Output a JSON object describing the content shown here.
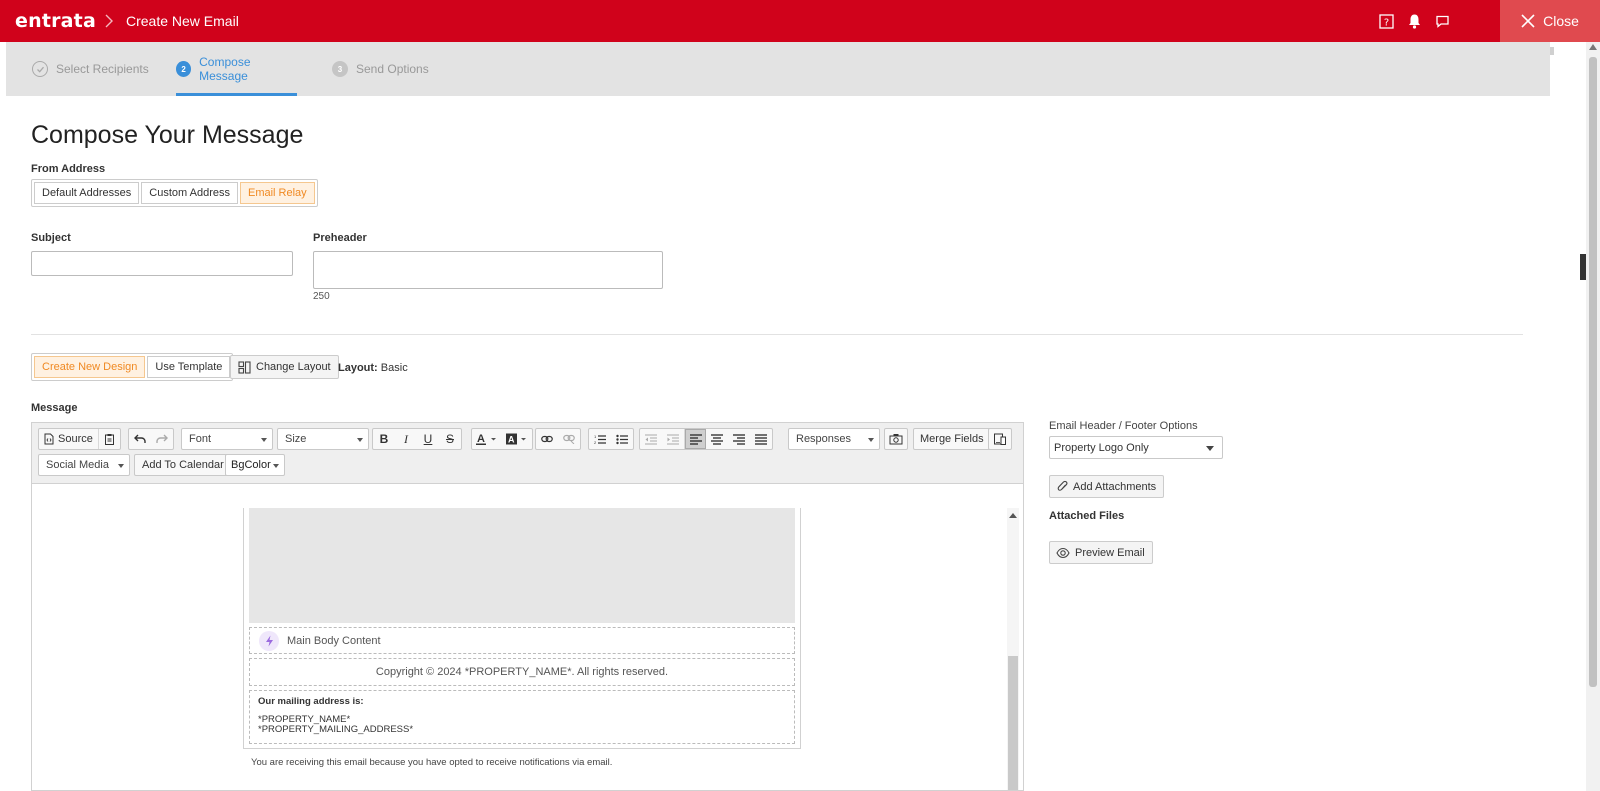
{
  "header": {
    "brand": "entrata",
    "page_name": "Create New Email",
    "close_label": "Close",
    "icons": [
      "help-icon",
      "bell-icon",
      "chat-icon"
    ]
  },
  "steps": [
    {
      "label": "Select Recipients",
      "state": "done"
    },
    {
      "number": "2",
      "label": "Compose Message",
      "state": "active"
    },
    {
      "number": "3",
      "label": "Send Options",
      "state": "pending"
    }
  ],
  "main": {
    "title": "Compose Your Message",
    "from_address": {
      "label": "From Address",
      "options": [
        "Default Addresses",
        "Custom Address",
        "Email Relay"
      ],
      "selected": "Email Relay"
    },
    "subject": {
      "label": "Subject",
      "value": ""
    },
    "preheader": {
      "label": "Preheader",
      "value": "",
      "char_count": "250"
    },
    "design": {
      "options": [
        "Create New Design",
        "Use Template"
      ],
      "selected": "Create New Design",
      "change_layout_label": "Change Layout",
      "layout_label": "Layout:",
      "layout_value": "Basic"
    },
    "message_label": "Message"
  },
  "toolbar": {
    "source_label": "Source",
    "font_label": "Font",
    "size_label": "Size",
    "responses_label": "Responses",
    "merge_fields_label": "Merge Fields",
    "social_media_label": "Social Media",
    "add_to_calendar_label": "Add To Calendar",
    "bgcolor_label": "BgColor",
    "bold": "B",
    "italic": "I",
    "underline": "U",
    "strike": "S"
  },
  "email_body": {
    "main_body": "Main Body Content",
    "copyright": "Copyright © 2024 *PROPERTY_NAME*. All rights reserved.",
    "mailing_heading": "Our mailing address is:",
    "mailing_name": "*PROPERTY_NAME*",
    "mailing_address": "*PROPERTY_MAILING_ADDRESS*",
    "note": "You are receiving this email because you have opted to receive notifications via email."
  },
  "right_panel": {
    "header_footer_label": "Email Header / Footer Options",
    "header_footer_value": "Property Logo Only",
    "add_attachments_label": "Add Attachments",
    "attached_files_label": "Attached Files",
    "preview_label": "Preview Email"
  },
  "colors": {
    "brand_red": "#d0021b",
    "active_blue": "#3a8fd9",
    "selected_orange": "#f08a24"
  }
}
